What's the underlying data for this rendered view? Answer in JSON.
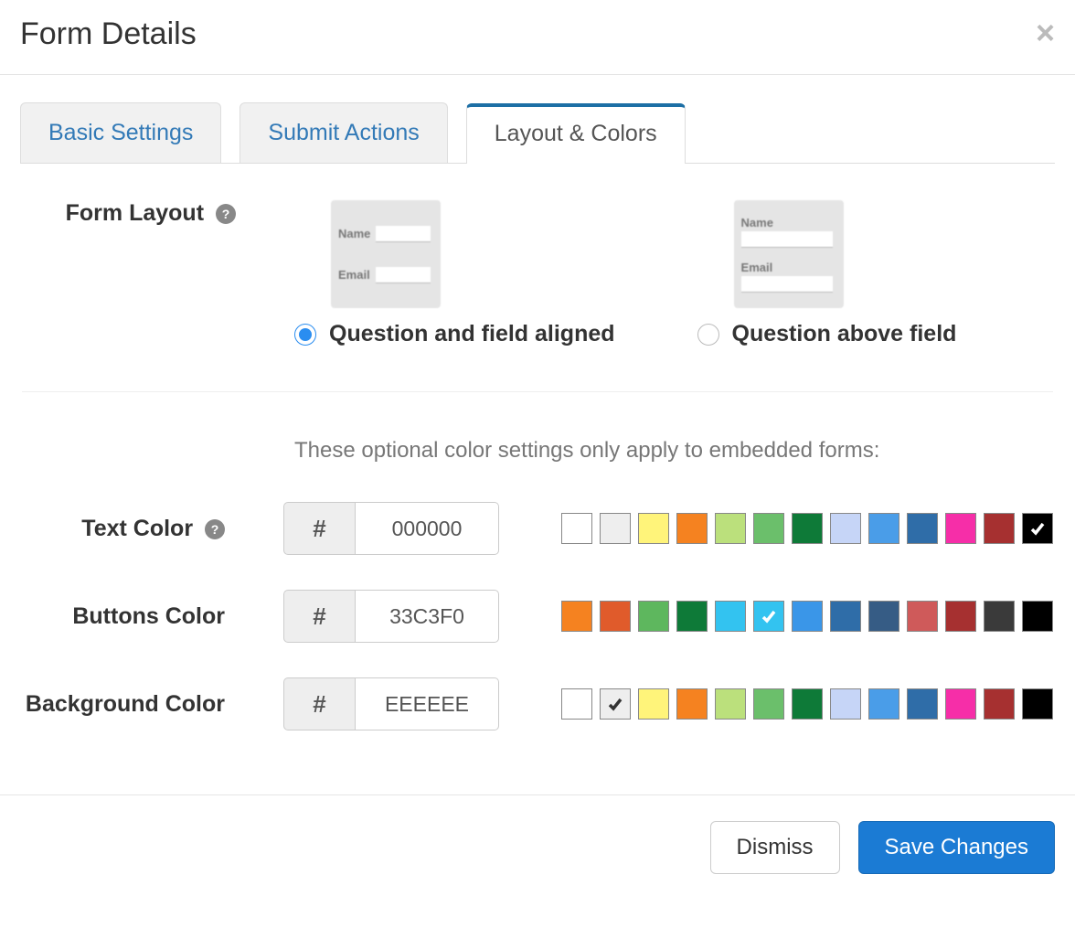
{
  "header": {
    "title": "Form Details"
  },
  "tabs": [
    {
      "label": "Basic Settings",
      "active": false
    },
    {
      "label": "Submit Actions",
      "active": false
    },
    {
      "label": "Layout & Colors",
      "active": true
    }
  ],
  "form_layout": {
    "label": "Form Layout",
    "options": [
      {
        "label": "Question and field aligned",
        "selected": true
      },
      {
        "label": "Question above field",
        "selected": false
      }
    ],
    "preview_fields": [
      "Name",
      "Email"
    ]
  },
  "color_hint": "These optional color settings only apply to embedded forms:",
  "colors": {
    "text": {
      "label": "Text Color",
      "value": "000000",
      "swatches": [
        "FFFFFF",
        "EEEEEE",
        "FFF47A",
        "F58220",
        "BBE07C",
        "6BBF6B",
        "0E7A38",
        "C6D5F7",
        "4A9DE8",
        "2F6DA8",
        "F62EA8",
        "A63030",
        "000000"
      ],
      "selected_index": 12,
      "has_help": true
    },
    "buttons": {
      "label": "Buttons Color",
      "value": "33C3F0",
      "swatches": [
        "F58220",
        "E05B2B",
        "5EB75E",
        "0E7A38",
        "33C3F0",
        "33C3F0",
        "3A96E8",
        "2F6DA8",
        "365C85",
        "CF5A5A",
        "A63030",
        "3A3A3A",
        "000000"
      ],
      "selected_index": 5,
      "has_help": false
    },
    "background": {
      "label": "Background Color",
      "value": "EEEEEE",
      "swatches": [
        "FFFFFF",
        "EEEEEE",
        "FFF47A",
        "F58220",
        "BBE07C",
        "6BBF6B",
        "0E7A38",
        "C6D5F7",
        "4A9DE8",
        "2F6DA8",
        "F62EA8",
        "A63030",
        "000000"
      ],
      "selected_index": 1,
      "has_help": false
    }
  },
  "footer": {
    "dismiss": "Dismiss",
    "save": "Save Changes"
  }
}
